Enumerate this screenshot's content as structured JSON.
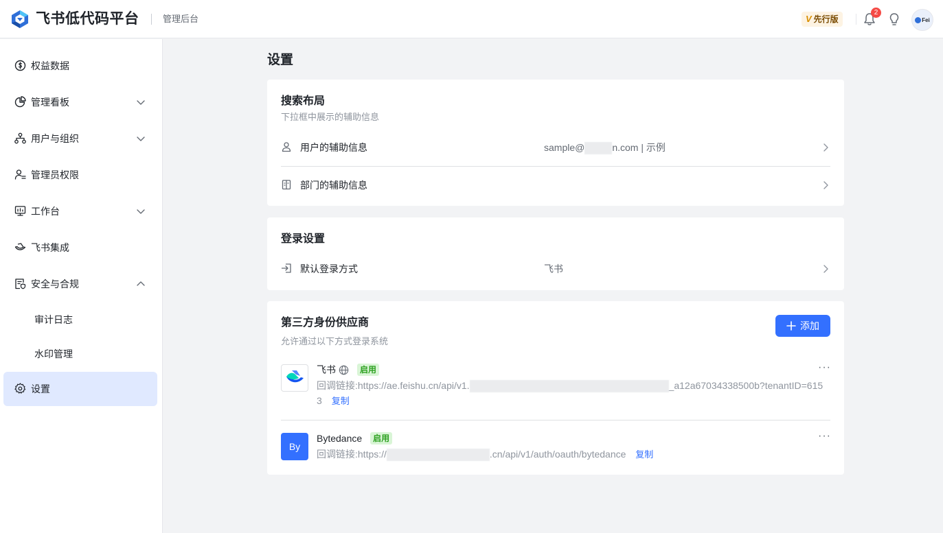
{
  "header": {
    "app_name": "飞书低代码平台",
    "sub_title": "管理后台",
    "plan_badge_mark": "V",
    "plan_badge": "先行版",
    "notification_count": "2",
    "avatar_text": "Fei"
  },
  "sidebar": {
    "items": [
      {
        "label": "权益数据",
        "icon": "dollar-circle-icon"
      },
      {
        "label": "管理看板",
        "icon": "pie-chart-icon"
      },
      {
        "label": "用户与组织",
        "icon": "org-chart-icon"
      },
      {
        "label": "管理员权限",
        "icon": "admin-user-icon"
      },
      {
        "label": "工作台",
        "icon": "monitor-icon"
      },
      {
        "label": "飞书集成",
        "icon": "feishu-integration-icon"
      },
      {
        "label": "安全与合规",
        "icon": "security-doc-icon"
      },
      {
        "label": "审计日志"
      },
      {
        "label": "水印管理"
      },
      {
        "label": "设置",
        "icon": "gear-icon"
      }
    ]
  },
  "main": {
    "page_title": "设置",
    "search_layout": {
      "title": "搜索布局",
      "desc": "下拉框中展示的辅助信息",
      "rows": [
        {
          "label": "用户的辅助信息",
          "value_prefix": "sample@",
          "value_suffix": "n.com | 示例"
        },
        {
          "label": "部门的辅助信息",
          "value": ""
        }
      ]
    },
    "login": {
      "title": "登录设置",
      "row_label": "默认登录方式",
      "row_value": "飞书"
    },
    "idp": {
      "title": "第三方身份供应商",
      "desc": "允许通过以下方式登录系统",
      "add_label": "添加",
      "providers": [
        {
          "name": "飞书",
          "status": "启用",
          "url_label": "回调链接:",
          "url_prefix": "https://ae.feishu.cn/api/v1.",
          "url_suffix": "_a12a67034338500b?tenantID=615",
          "url_tail": "3",
          "copy": "复制",
          "more": "···"
        },
        {
          "name": "Bytedance",
          "logo_text": "By",
          "status": "启用",
          "url_label": "回调链接:",
          "url_prefix": "https://",
          "url_suffix": ".cn/api/v1/auth/oauth/bytedance",
          "copy": "复制",
          "more": "···"
        }
      ]
    }
  },
  "colors": {
    "primary": "#3370ff",
    "active_nav_bg": "#e0e9ff",
    "enabled_tag_bg": "#d9f5d6",
    "enabled_tag_text": "#2ea121",
    "badge_red": "#f54a45"
  }
}
